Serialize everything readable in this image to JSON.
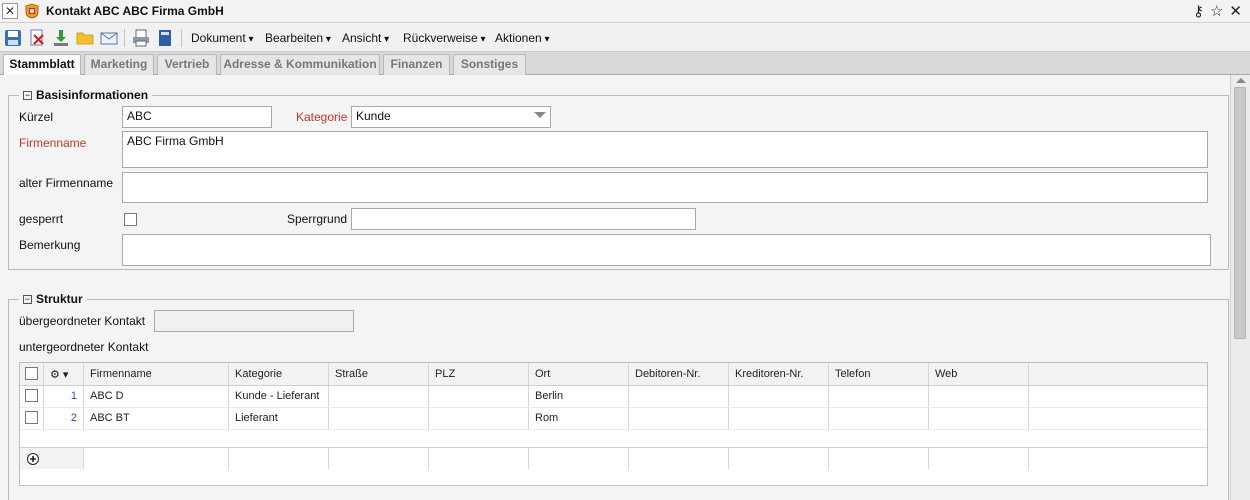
{
  "window": {
    "title": "Kontakt ABC ABC Firma GmbH"
  },
  "toolbar": {
    "menus": [
      "Dokument",
      "Bearbeiten",
      "Ansicht",
      "Rückverweise",
      "Aktionen"
    ]
  },
  "tabs": [
    "Stammblatt",
    "Marketing",
    "Vertrieb",
    "Adresse & Kommunikation",
    "Finanzen",
    "Sonstiges"
  ],
  "basis": {
    "legend": "Basisinformationen",
    "kuerzel_label": "Kürzel",
    "kuerzel_value": "ABC",
    "kategorie_label": "Kategorie",
    "kategorie_value": "Kunde",
    "firmenname_label": "Firmenname",
    "firmenname_value": "ABC Firma GmbH",
    "alter_label": "alter Firmenname",
    "alter_value": "",
    "gesperrt_label": "gesperrt",
    "sperrgrund_label": "Sperrgrund",
    "sperrgrund_value": "",
    "bemerkung_label": "Bemerkung",
    "bemerkung_value": ""
  },
  "struktur": {
    "legend": "Struktur",
    "parent_label": "übergeordneter Kontakt",
    "parent_value": "",
    "child_label": "untergeordneter Kontakt",
    "columns": [
      "Firmenname",
      "Kategorie",
      "Straße",
      "PLZ",
      "Ort",
      "Debitoren-Nr.",
      "Kreditoren-Nr.",
      "Telefon",
      "Web"
    ],
    "rows": [
      {
        "num": "1",
        "firmenname": "ABC D",
        "kategorie": "Kunde - Lieferant",
        "strasse": "",
        "plz": "",
        "ort": "Berlin",
        "debitoren": "",
        "kreditoren": "",
        "telefon": "",
        "web": ""
      },
      {
        "num": "2",
        "firmenname": "ABC BT",
        "kategorie": "Lieferant",
        "strasse": "",
        "plz": "",
        "ort": "Rom",
        "debitoren": "",
        "kreditoren": "",
        "telefon": "",
        "web": ""
      }
    ]
  },
  "colors": {
    "required_label": "#c0392b",
    "row_number": "#2255bb"
  }
}
